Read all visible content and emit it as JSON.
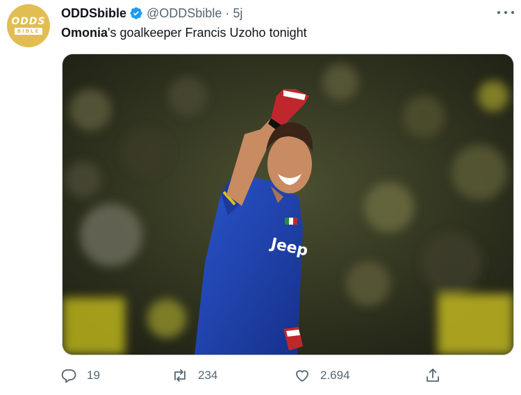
{
  "account": {
    "avatar_line1": "ODDS",
    "avatar_line2": "BIBLE",
    "display_name": "ODDSbible",
    "handle": "@ODDSbible",
    "separator": "·",
    "time": "5j",
    "verified_icon": "verified-badge-icon",
    "brand_color": "#e2bd52",
    "verified_color": "#1d9bf0"
  },
  "tweet": {
    "text_bold": "Omonia",
    "text_rest": "'s goalkeeper Francis Uzoho tonight",
    "photo": {
      "jersey_text": "Jeep",
      "jersey_color": "#1e3fa8"
    }
  },
  "actions": {
    "replies": "19",
    "retweets": "234",
    "likes": "2.694",
    "icons": [
      "reply-icon",
      "retweet-icon",
      "like-icon",
      "share-icon"
    ]
  }
}
